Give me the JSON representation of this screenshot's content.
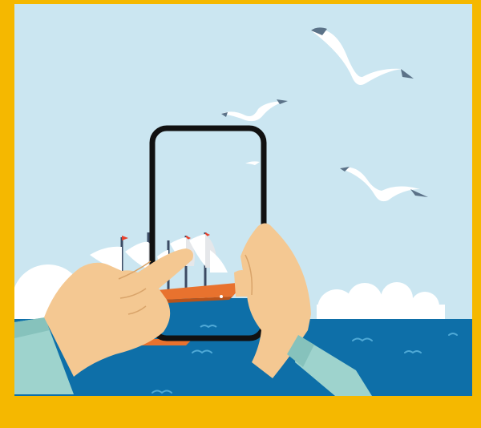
{
  "scene": {
    "colors": {
      "frame": "#f5b800",
      "sky": "#cbe6f1",
      "sea": "#0e6fa8",
      "sea_dark": "#0b5f92",
      "wave": "#4fa9d6",
      "cloud": "#ffffff",
      "cloud_shadow": "#e3eff5",
      "sail": "#ffffff",
      "sail_shade": "#e5e7ea",
      "hull": "#e8722e",
      "hull_dark": "#b8531b",
      "mast": "#3b4a63",
      "flag": "#e8412c",
      "gull_body": "#ffffff",
      "gull_tip": "#5b7288",
      "phone_outline": "#111111",
      "skin": "#f4c892",
      "skin_line": "#d9a46a",
      "sleeve": "#9ed3cd",
      "sleeve_shade": "#86c2bc"
    },
    "icons": [
      "seagull-icon",
      "sailing-ship-icon",
      "smartphone-icon",
      "hand-icon",
      "cloud-icon",
      "wave-icon"
    ]
  }
}
